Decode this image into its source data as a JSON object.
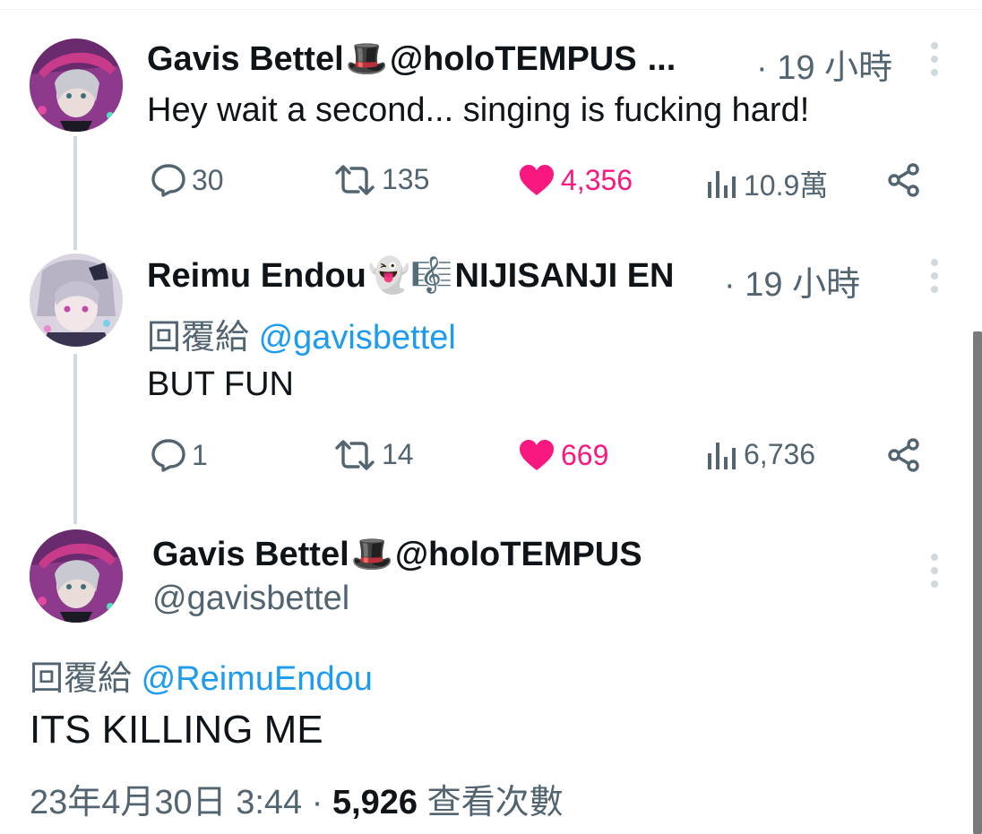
{
  "tweets": [
    {
      "display_name": "Gavis Bettel",
      "name_emoji": "🎩",
      "name_suffix": "@holoTEMPUS",
      "truncation": "...",
      "time": "· 19 小時",
      "text": "Hey wait a second... singing is fucking hard!",
      "actions": {
        "replies": "30",
        "retweets": "135",
        "likes": "4,356",
        "views": "10.9萬"
      }
    },
    {
      "display_name": "Reimu Endou",
      "name_emoji": "👻🎼",
      "name_suffix": "NIJISANJI EN",
      "time": "· 19 小時",
      "reply_prefix": "回覆給",
      "reply_mention": "@gavisbettel",
      "text": "BUT FUN",
      "actions": {
        "replies": "1",
        "retweets": "14",
        "likes": "669",
        "views": "6,736"
      }
    }
  ],
  "focused_tweet": {
    "display_name": "Gavis Bettel",
    "name_emoji": "🎩",
    "name_suffix": "@holoTEMPUS",
    "handle": "@gavisbettel",
    "reply_prefix": "回覆給",
    "reply_mention": "@ReimuEndou",
    "text": "ITS KILLING ME",
    "timestamp": "23年4月30日 3:44",
    "separator": "·",
    "views_count": "5,926",
    "views_label": "查看次數"
  },
  "colors": {
    "like": "#f91880",
    "link": "#1d9bf0",
    "muted": "#536471",
    "line": "#cfd9de"
  }
}
